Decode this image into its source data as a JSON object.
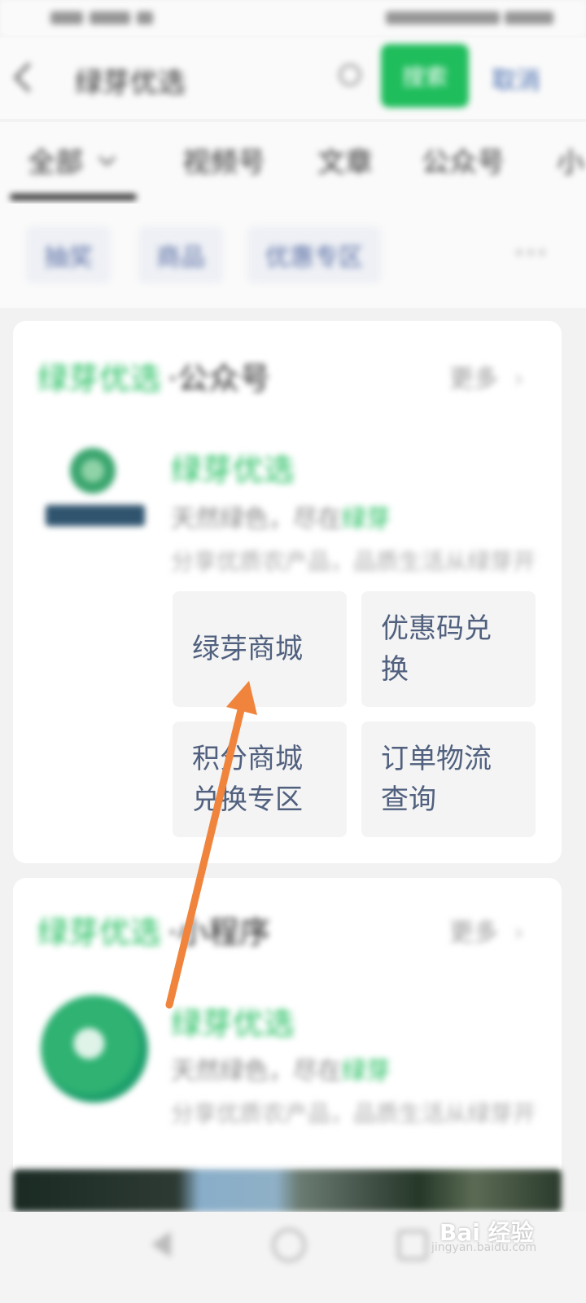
{
  "search": {
    "query": "绿芽优选",
    "button_label": "搜索",
    "cancel_label": "取消"
  },
  "tabs": [
    "全部",
    "视频号",
    "文章",
    "公众号",
    "小"
  ],
  "chips": [
    "抽奖",
    "商品",
    "优惠专区"
  ],
  "official_account_card": {
    "title": "绿芽优选",
    "title_suffix": "·公众号",
    "more": "更多",
    "name": "绿芽优选",
    "desc_prefix": "天然绿色，尽在",
    "desc_highlight": "绿芽",
    "desc_line2": "分享优质农产品，品质生活从绿芽开始…",
    "menu": [
      "绿芽商城",
      "优惠码兑换",
      "积分商城兑换专区",
      "订单物流查询"
    ]
  },
  "mini_program_card": {
    "title": "绿芽优选",
    "title_suffix": "·小程序",
    "more": "更多",
    "name": "绿芽优选",
    "desc_prefix": "天然绿色，尽在",
    "desc_highlight": "绿芽",
    "desc_line2": "分享优质农产品，品质生活从绿芽开始…"
  },
  "watermark": {
    "main": "Bai 经验",
    "sub": "jingyan.baidu.com"
  },
  "colors": {
    "brand_green": "#1fbd5c",
    "link_blue": "#4a6fb0",
    "arrow": "#f0843c"
  }
}
